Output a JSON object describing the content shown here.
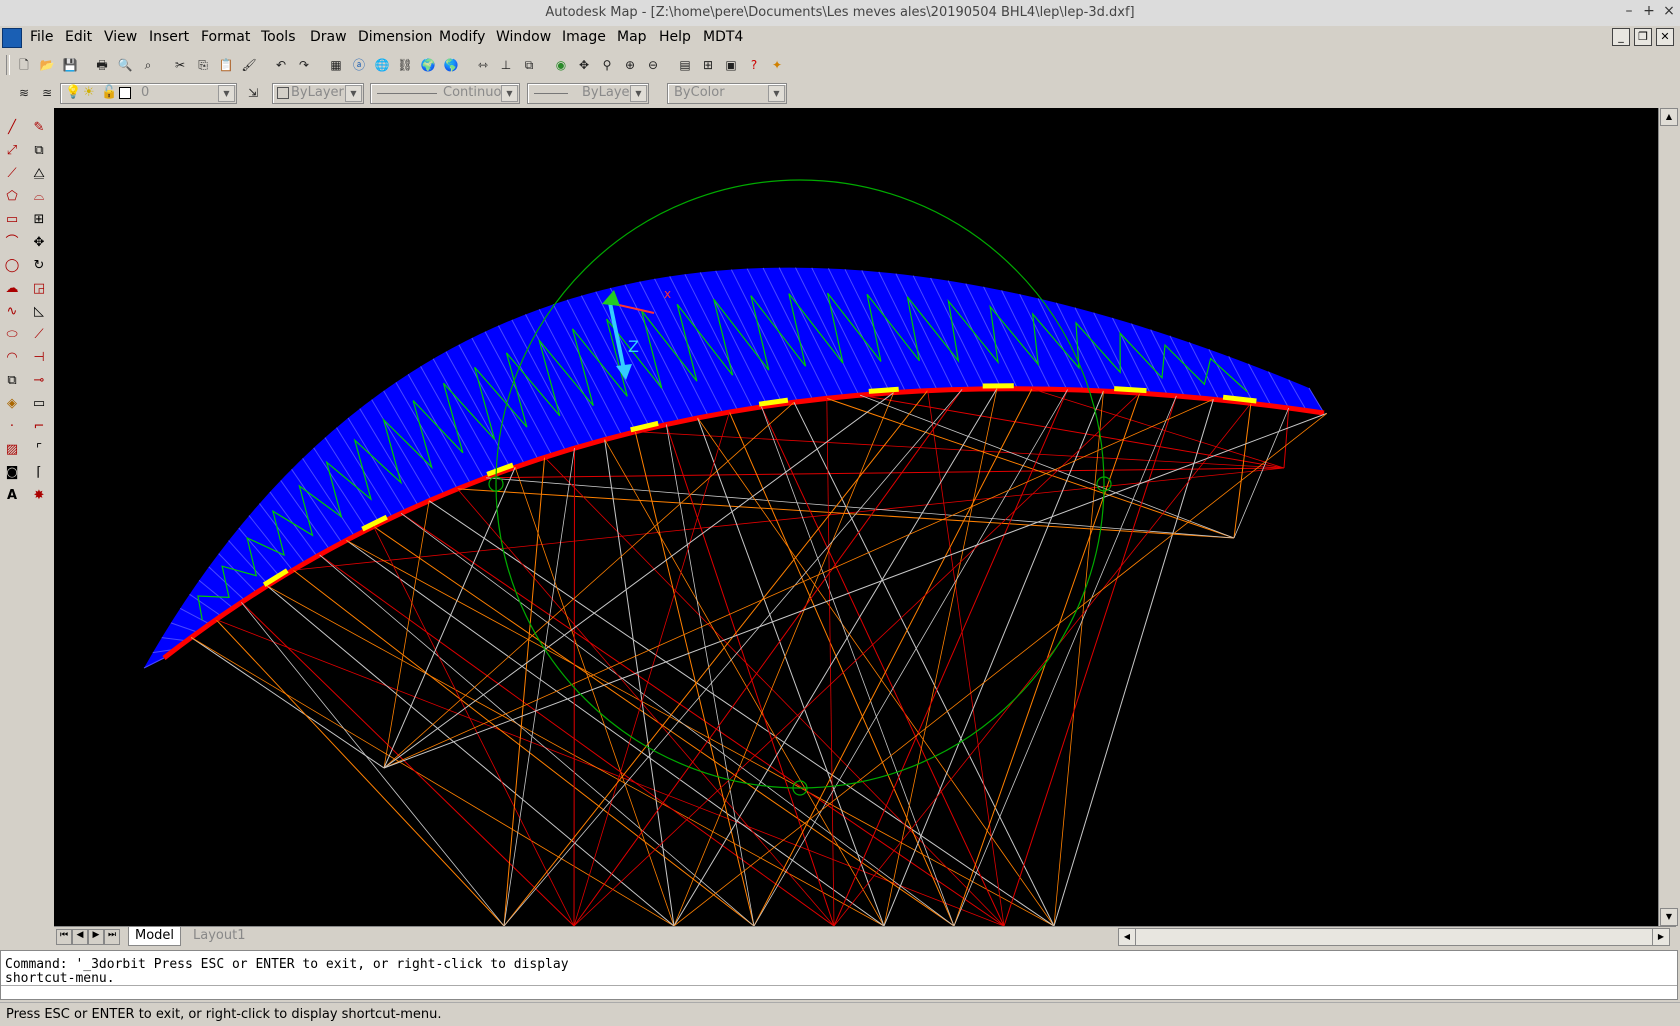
{
  "window": {
    "title": "Autodesk Map - [Z:\\home\\pere\\Documents\\Les meves ales\\20190504 BHL4\\lep\\lep-3d.dxf]",
    "controls": [
      "–",
      "+",
      "×"
    ]
  },
  "menu": [
    "File",
    "Edit",
    "View",
    "Insert",
    "Format",
    "Tools",
    "Draw",
    "Dimension",
    "Modify",
    "Window",
    "Image",
    "Map",
    "Help",
    "MDT4"
  ],
  "properties": {
    "layer_value": "0",
    "color_value": "ByLayer",
    "linetype_value": "Continuous",
    "lineweight_value": "ByLayer",
    "plotstyle_value": "ByColor"
  },
  "canvas": {
    "ucs_axis_label": "Z",
    "ucs_axis_label_x": "x",
    "colors": {
      "canopy": "#0000ff",
      "leading_edge": "#ff0000",
      "ribs": "#00cc00",
      "highlights": "#ffff00",
      "lines_grey": "#c8c8c8",
      "lines_orange": "#ff8000",
      "lines_red": "#e00000",
      "orbit_circle": "#00aa00"
    }
  },
  "tabs": {
    "model": "Model",
    "layout1": "Layout1"
  },
  "command": {
    "line1": "Command: '_3dorbit Press ESC or ENTER to exit, or right-click to display",
    "line2": "shortcut-menu."
  },
  "status": "Press ESC or ENTER to exit, or right-click to display shortcut-menu."
}
